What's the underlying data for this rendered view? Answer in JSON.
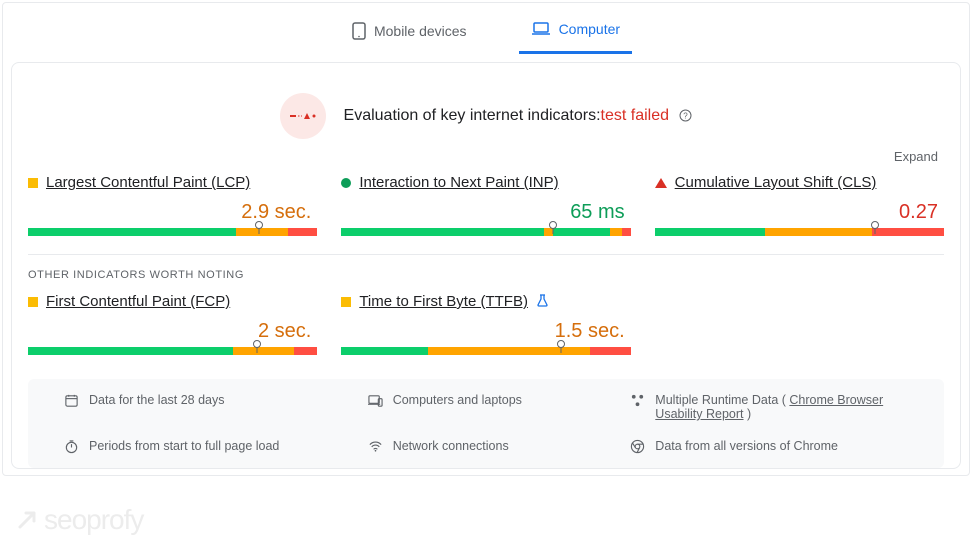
{
  "tabs": {
    "mobile": "Mobile devices",
    "computer": "Computer"
  },
  "hero": {
    "title_prefix": "Evaluation of key internet indicators:",
    "title_status": "test failed"
  },
  "expand": "Expand",
  "metrics": {
    "lcp": {
      "name": "Largest Contentful Paint (LCP)",
      "value": "2.9 sec."
    },
    "inp": {
      "name": "Interaction to Next Paint (INP)",
      "value": "65 ms"
    },
    "cls": {
      "name": "Cumulative Layout Shift (CLS)",
      "value": "0.27"
    }
  },
  "section_label": "OTHER INDICATORS WORTH NOTING",
  "other": {
    "fcp": {
      "name": "First Contentful Paint (FCP)",
      "value": "2 sec."
    },
    "ttfb": {
      "name": "Time to First Byte (TTFB)",
      "value": "1.5 sec."
    }
  },
  "footer": {
    "period": "Data for the last 28 days",
    "device": "Computers and laptops",
    "report_prefix": "Multiple Runtime Data ( ",
    "report_link": "Chrome Browser Usability Report",
    "report_suffix": " )",
    "timing": "Periods from start to full page load",
    "network": "Network connections",
    "chrome": "Data from all versions of Chrome"
  },
  "watermark": "seoprofy"
}
